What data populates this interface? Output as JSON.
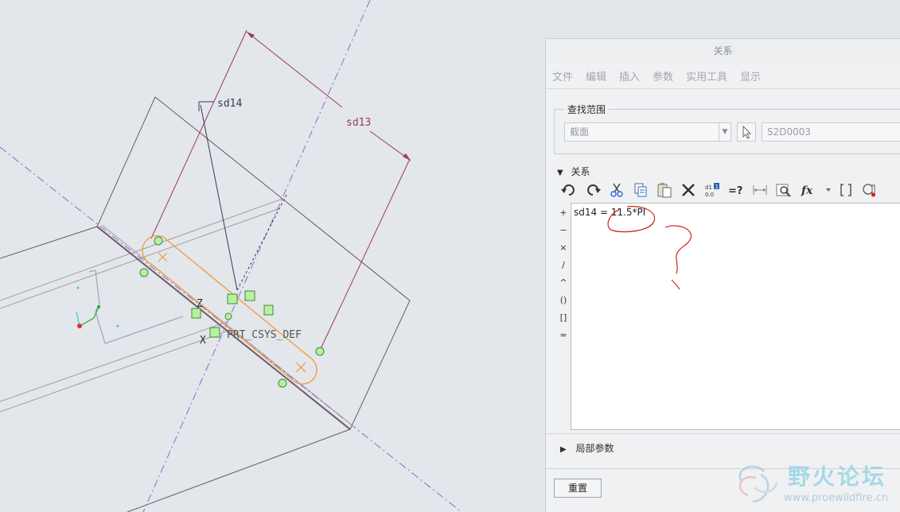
{
  "canvas": {
    "dim_sd14": "sd14",
    "dim_sd13": "sd13",
    "csys_label": "PRT_CSYS_DEF",
    "axis_x": "X",
    "axis_z": "Z"
  },
  "dialog": {
    "title": "关系",
    "menu": [
      "文件",
      "编辑",
      "插入",
      "参数",
      "实用工具",
      "显示"
    ],
    "find_scope": {
      "legend": "查找范围",
      "scope_value": "截面",
      "item_value": "S2D0003"
    },
    "relations_label": "关系",
    "operators": [
      "+",
      "−",
      "×",
      "/",
      "^",
      "()",
      "[]",
      "="
    ],
    "relation_text": "sd14 = 11.5*PI",
    "local_params_label": "局部参数",
    "reset_label": "重置"
  },
  "watermark": {
    "name": "野火论坛",
    "url": "www.proewildfire.cn"
  }
}
